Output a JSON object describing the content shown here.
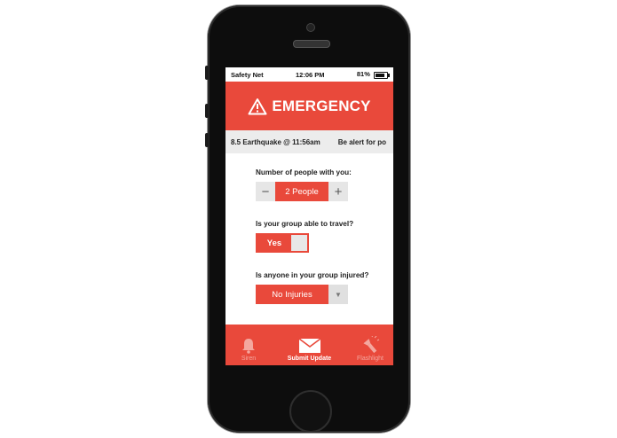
{
  "status_bar": {
    "carrier": "Safety Net",
    "time": "12:06 PM",
    "battery": "81%",
    "battery_level": 0.81
  },
  "header": {
    "title": "EMERGENCY"
  },
  "ticker": {
    "items": [
      "8.5 Earthquake @ 11:56am",
      "Be alert for po"
    ]
  },
  "form": {
    "people": {
      "question": "Number of people with you:",
      "minus": "−",
      "value": "2 People",
      "plus": "+"
    },
    "travel": {
      "question": "Is your group able to travel?",
      "value": "Yes"
    },
    "injured": {
      "question": "Is anyone in your group injured?",
      "value": "No Injuries",
      "arrow": "▼"
    }
  },
  "tabbar": {
    "tabs": [
      {
        "label": "Siren",
        "icon": "bell-icon"
      },
      {
        "label": "Submit Update",
        "icon": "envelope-icon"
      },
      {
        "label": "Flashlight",
        "icon": "flashlight-icon"
      }
    ]
  },
  "colors": {
    "accent": "#e9493b",
    "control_gray": "#e6e6e6",
    "ticker_bg": "#ececec"
  }
}
